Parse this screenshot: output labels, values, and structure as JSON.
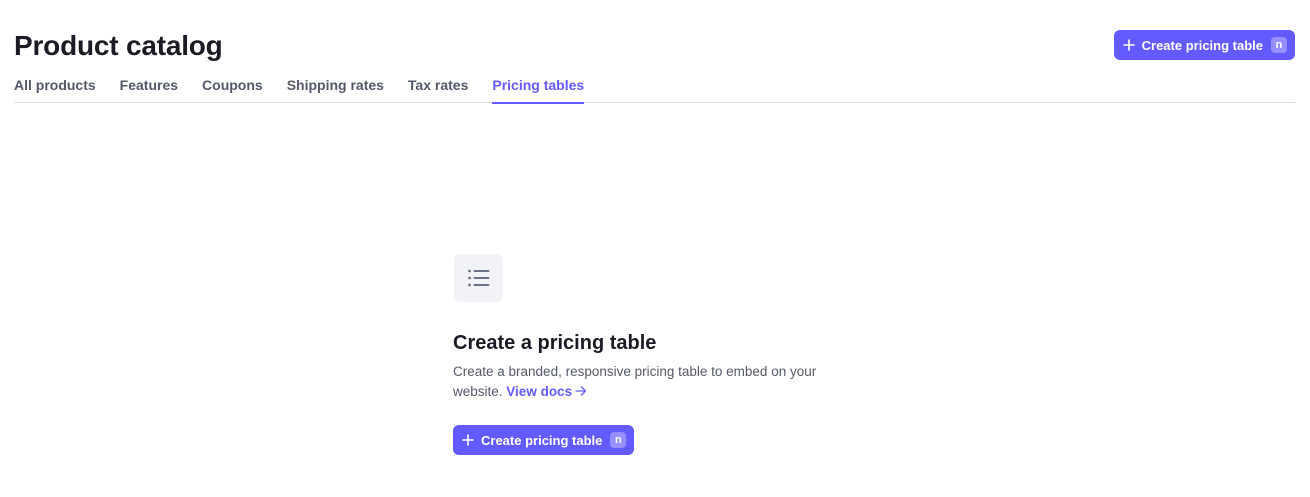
{
  "header": {
    "title": "Product catalog",
    "create_button": {
      "label": "Create pricing table",
      "shortcut": "n"
    }
  },
  "tabs": [
    {
      "label": "All products",
      "active": false
    },
    {
      "label": "Features",
      "active": false
    },
    {
      "label": "Coupons",
      "active": false
    },
    {
      "label": "Shipping rates",
      "active": false
    },
    {
      "label": "Tax rates",
      "active": false
    },
    {
      "label": "Pricing tables",
      "active": true
    }
  ],
  "empty_state": {
    "icon": "list-icon",
    "title": "Create a pricing table",
    "description": "Create a branded, responsive pricing table to embed on your website.",
    "link_label": "View docs",
    "button": {
      "label": "Create pricing table",
      "shortcut": "n"
    }
  },
  "colors": {
    "accent": "#635bff",
    "text_primary": "#1a1b25",
    "text_secondary": "#545969",
    "divider": "#dcdde3",
    "icon_bg": "#f2f3f6"
  }
}
